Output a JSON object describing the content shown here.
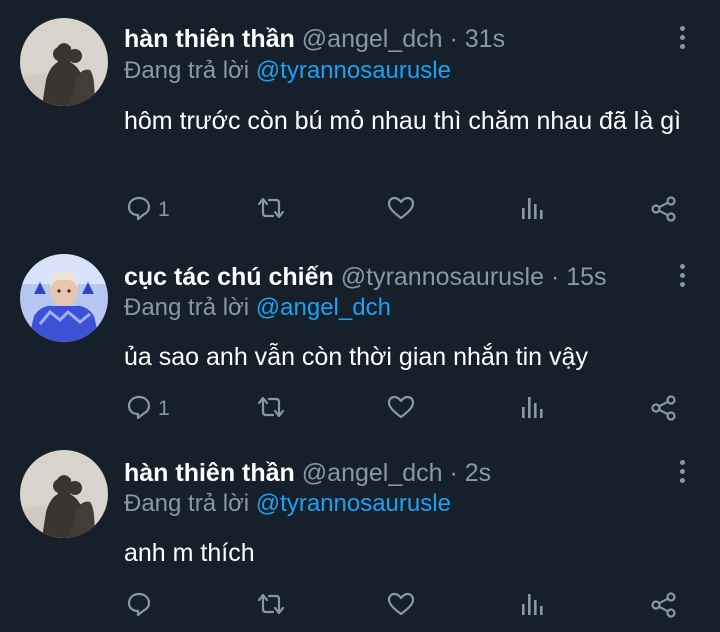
{
  "tweets": [
    {
      "display_name": "hàn thiên thần",
      "handle": "@angel_dch",
      "separator": "·",
      "time": "31s",
      "reply_prefix": "Đang trả lời",
      "reply_to": "@tyrannosaurusle",
      "text": "hôm trước còn bú mỏ nhau thì chăm nhau đã là gì",
      "reply_count": "1",
      "avatar": "shadow-photo-avatar"
    },
    {
      "display_name": "cục tác chú chiến",
      "handle": "@tyrannosaurusle",
      "separator": "·",
      "time": "15s",
      "reply_prefix": "Đang trả lời",
      "reply_to": "@angel_dch",
      "text": "ủa sao anh vẫn còn thời gian nhắn tin vậy",
      "reply_count": "1",
      "avatar": "person-photo-avatar"
    },
    {
      "display_name": "hàn thiên thần",
      "handle": "@angel_dch",
      "separator": "·",
      "time": "2s",
      "reply_prefix": "Đang trả lời",
      "reply_to": "@tyrannosaurusle",
      "text": "anh m thích",
      "reply_count": "",
      "avatar": "shadow-photo-avatar"
    }
  ],
  "icons": [
    "reply-icon",
    "retweet-icon",
    "like-icon",
    "analytics-icon",
    "share-icon",
    "more-icon"
  ],
  "colors": {
    "background": "#15202b",
    "text_primary": "#ffffff",
    "text_secondary": "#8899a6",
    "link": "#1da1f2"
  }
}
